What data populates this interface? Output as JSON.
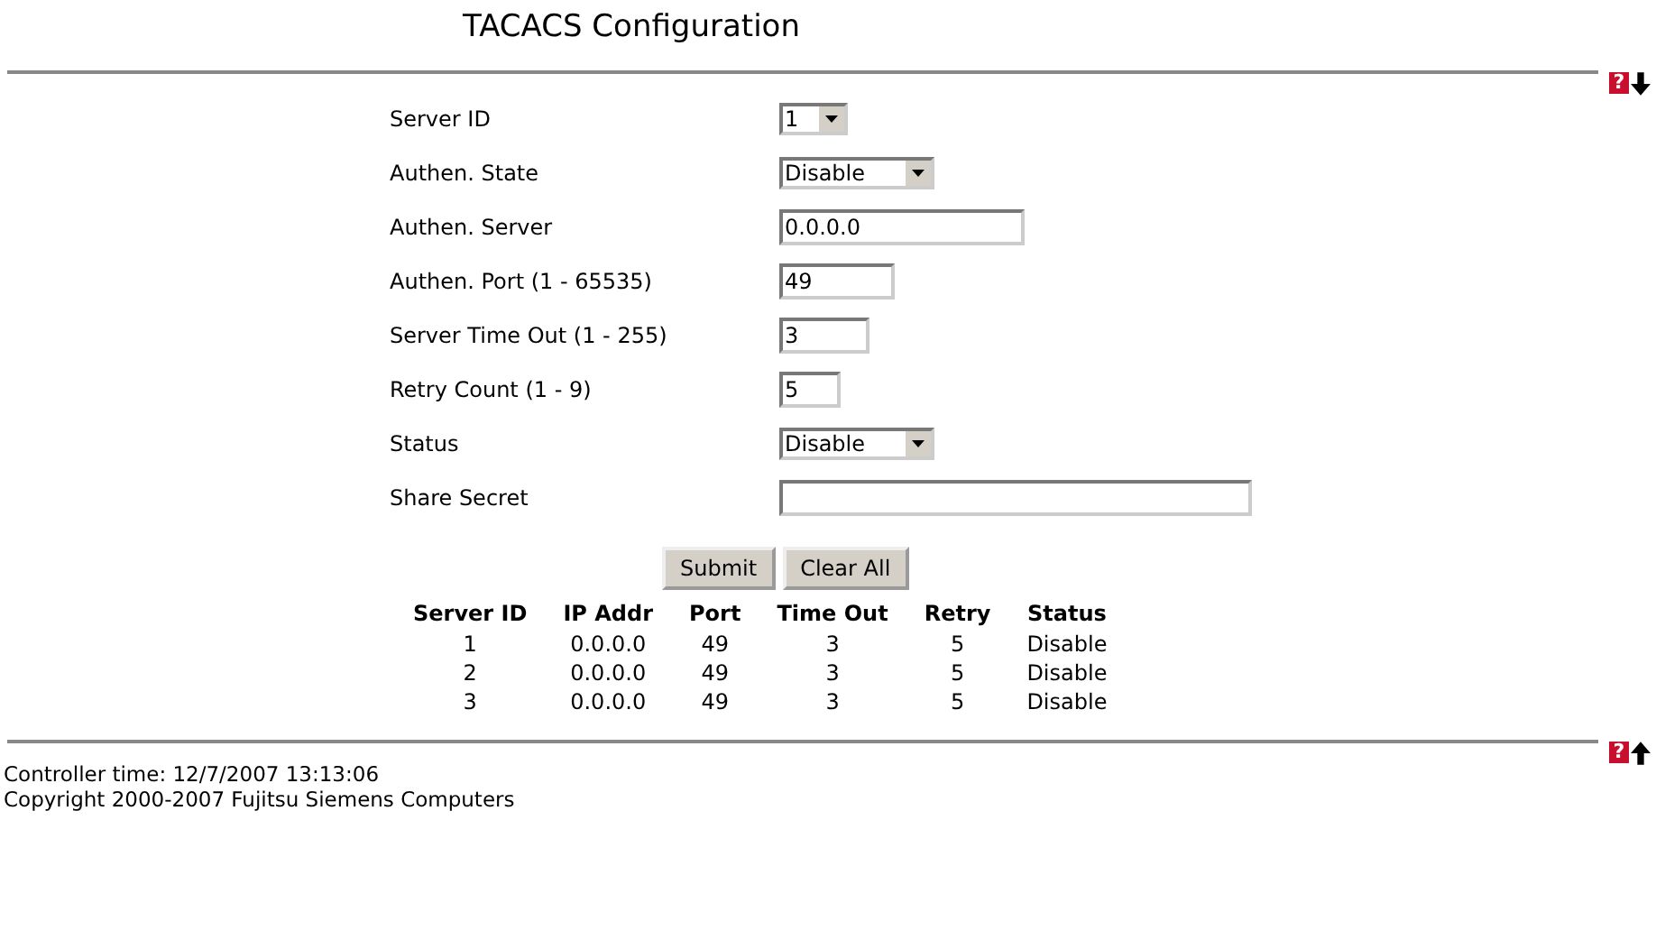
{
  "title": "TACACS Configuration",
  "top_nav": {
    "help": "?",
    "arrow_up": false
  },
  "form": [
    {
      "kind": "select",
      "label": "Server ID",
      "value": "1"
    },
    {
      "kind": "select",
      "label": "Authen. State",
      "value": "Disable"
    },
    {
      "kind": "text",
      "label": "Authen. Server",
      "value": "0.0.0.0"
    },
    {
      "kind": "text",
      "label": "Authen. Port (1 - 65535)",
      "value": "49"
    },
    {
      "kind": "text",
      "label": "Server Time Out (1 - 255)",
      "value": "3"
    },
    {
      "kind": "text",
      "label": "Retry Count (1 - 9)",
      "value": "5"
    },
    {
      "kind": "select",
      "label": "Status",
      "value": "Disable"
    },
    {
      "kind": "text",
      "label": "Share Secret"
    }
  ],
  "buttons": [
    "Submit",
    "Clear All"
  ],
  "table": {
    "columns": [
      "Server ID",
      "IP Addr",
      "Port",
      "Time Out",
      "Retry",
      "Status"
    ],
    "rows": [
      [
        "1",
        "0.0.0.0",
        "49",
        "3",
        "5",
        "Disable"
      ],
      [
        "2",
        "0.0.0.0",
        "49",
        "3",
        "5",
        "Disable"
      ],
      [
        "3",
        "0.0.0.0",
        "49",
        "3",
        "5",
        "Disable"
      ]
    ]
  },
  "bottom_nav": {
    "help": "?",
    "arrow_up": true
  },
  "footer": [
    "Controller time: 12/7/2007 13:13:06",
    "Copyright 2000-2007 Fujitsu Siemens Computers"
  ]
}
